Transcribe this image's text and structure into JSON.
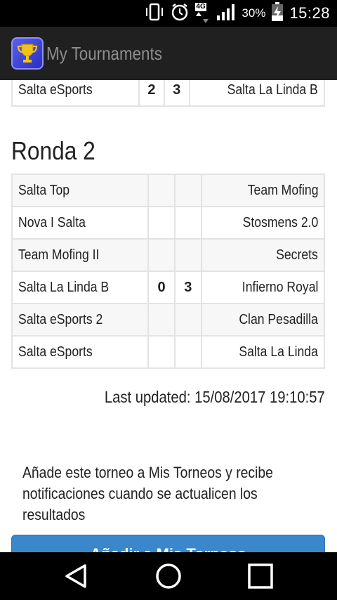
{
  "status_bar": {
    "network": "4G",
    "battery": "30%",
    "time": "15:28"
  },
  "app": {
    "title": "My Tournaments"
  },
  "round1_partial": {
    "matches": [
      {
        "home": "Salta eSports",
        "home_score": "2",
        "away_score": "3",
        "away": "Salta La Linda B"
      }
    ]
  },
  "round2": {
    "title": "Ronda 2",
    "matches": [
      {
        "home": "Salta Top",
        "home_score": "",
        "away_score": "",
        "away": "Team Mofing"
      },
      {
        "home": "Nova I Salta",
        "home_score": "",
        "away_score": "",
        "away": "Stosmens 2.0"
      },
      {
        "home": "Team Mofing II",
        "home_score": "",
        "away_score": "",
        "away": "Secrets"
      },
      {
        "home": "Salta La Linda B",
        "home_score": "0",
        "away_score": "3",
        "away": "Infierno Royal"
      },
      {
        "home": "Salta eSports 2",
        "home_score": "",
        "away_score": "",
        "away": "Clan Pesadilla"
      },
      {
        "home": "Salta eSports",
        "home_score": "",
        "away_score": "",
        "away": "Salta La Linda"
      }
    ]
  },
  "last_updated": "Last updated: 15/08/2017 19:10:57",
  "notify": {
    "text": "Añade este torneo a Mis Torneos y recibe notificaciones cuando se actualicen los resultados",
    "button_label": "Añadir a Mis Torneos"
  },
  "colors": {
    "status_bar": "#000000",
    "action_bar": "#202020",
    "button": "#3a87cc",
    "table_border": "#e3e3e3"
  }
}
